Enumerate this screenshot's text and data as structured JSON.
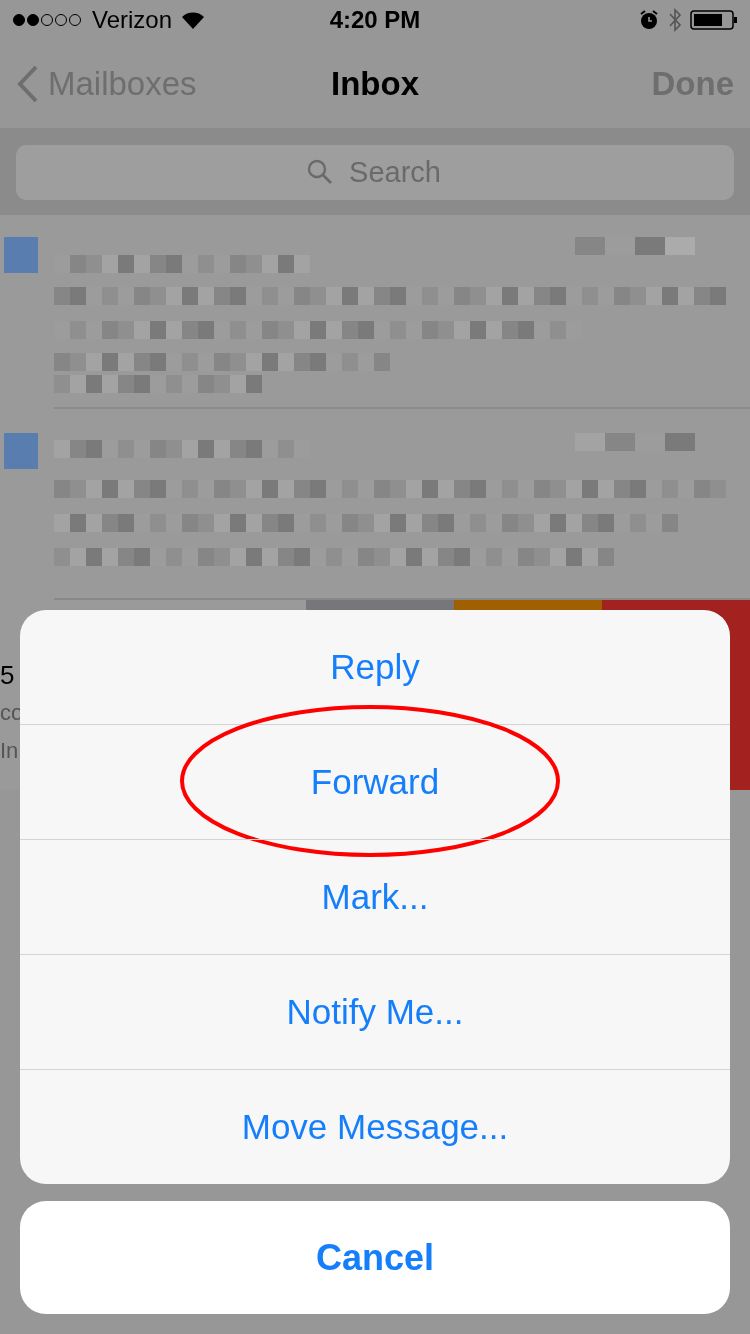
{
  "status_bar": {
    "carrier": "Verizon",
    "time": "4:20 PM"
  },
  "nav_bar": {
    "back": "Mailboxes",
    "title": "Inbox",
    "action": "Done"
  },
  "search": {
    "placeholder": "Search"
  },
  "swiped_row": {
    "texts": [
      "5",
      "co",
      "In"
    ],
    "actions": [
      {
        "color": "#77777b"
      },
      {
        "color": "#a05f00"
      },
      {
        "color": "#a3221f"
      }
    ]
  },
  "action_sheet": {
    "actions": [
      {
        "label": "Reply",
        "circled": false
      },
      {
        "label": "Forward",
        "circled": true
      },
      {
        "label": "Mark...",
        "circled": false
      },
      {
        "label": "Notify Me...",
        "circled": false
      },
      {
        "label": "Move Message...",
        "circled": false
      }
    ],
    "cancel": "Cancel"
  }
}
